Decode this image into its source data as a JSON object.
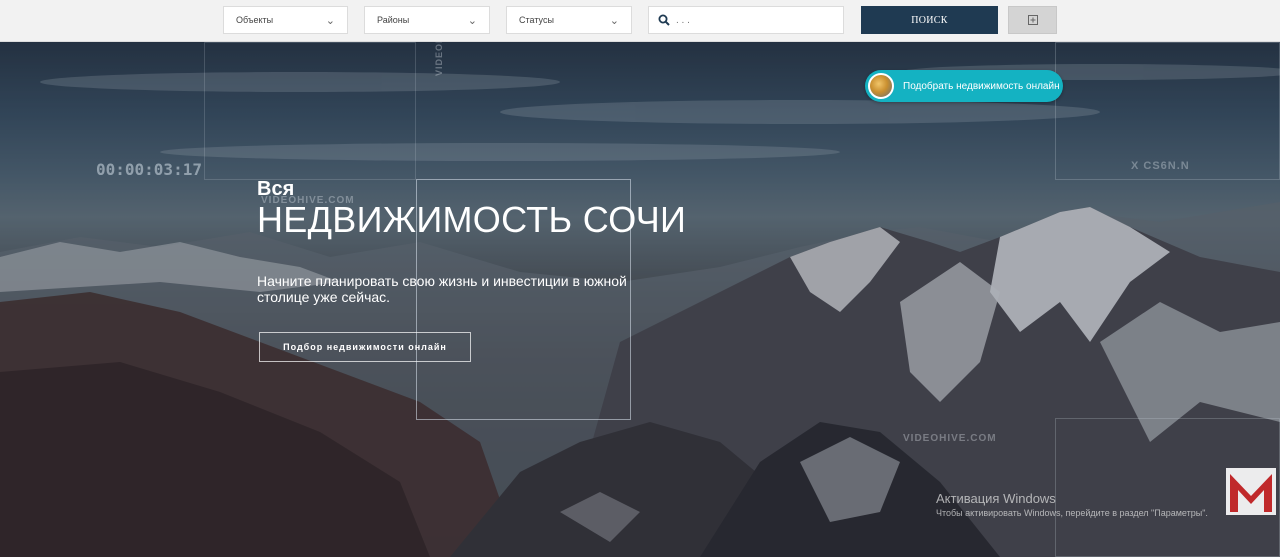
{
  "filters": {
    "objects_label": "Объекты",
    "districts_label": "Районы",
    "statuses_label": "Статусы",
    "search_placeholder": ". . .",
    "search_button": "ПОИСК"
  },
  "hero": {
    "watermark_top": "VIDEOHIVE.COM",
    "watermark_right": "X CS6N.N",
    "watermark_bottom": "VIDEOHIVE.COM",
    "watermark_vertical": "VIDEOH",
    "timecode": "00:00:03:17",
    "title_small": "Вся",
    "title_big": "НЕДВИЖИМОСТЬ СОЧИ",
    "subtitle": "Начните планировать свою жизнь и инвестиции в южной столице уже сейчас.",
    "cta_label": "Подбор недвижимости онлайн"
  },
  "pill": {
    "label": "Подобрать недвижимость онлайн"
  },
  "windows_notice": {
    "title": "Активация Windows",
    "subtitle": "Чтобы активировать Windows, перейдите в раздел \"Параметры\"."
  },
  "colors": {
    "search_button_bg": "#1f3a52",
    "pill_bg": "#14b2c2",
    "logo_red": "#c0292b"
  }
}
